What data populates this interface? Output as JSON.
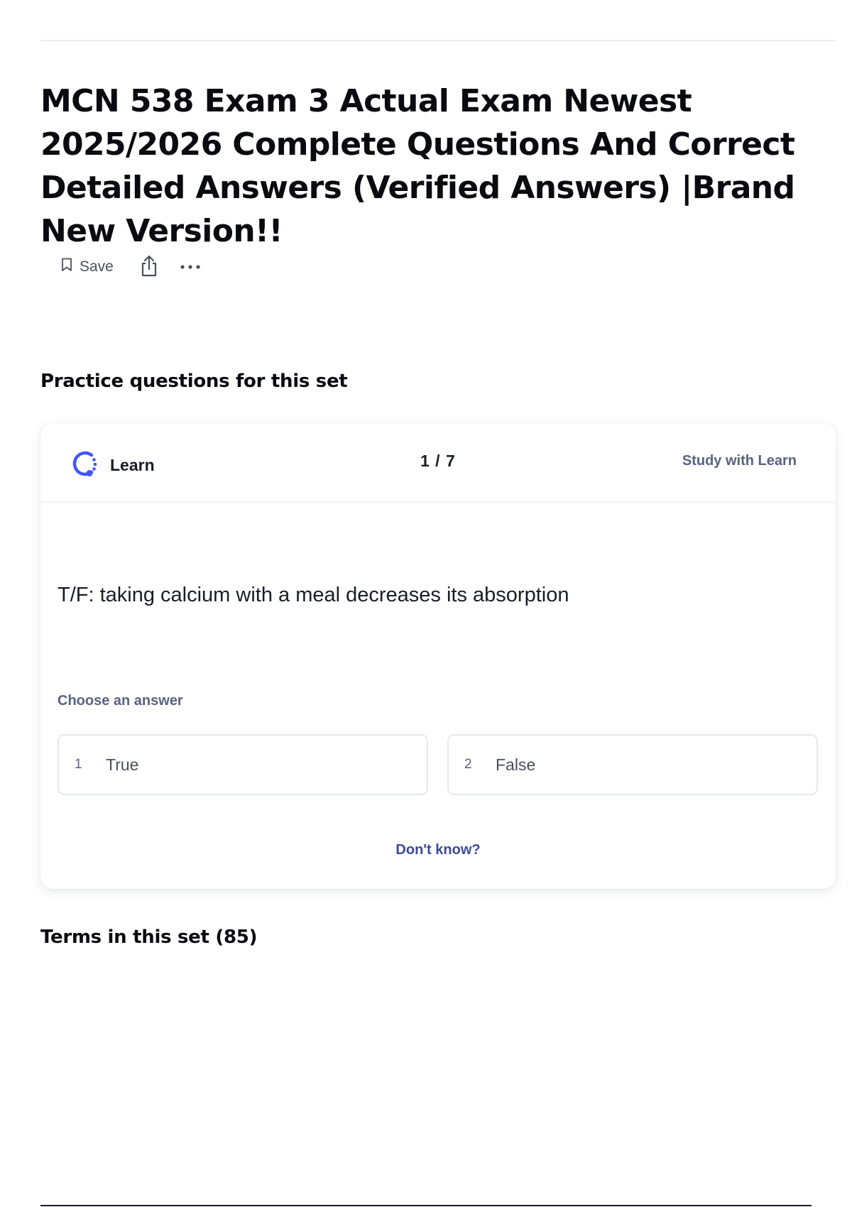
{
  "page": {
    "title": "MCN 538 Exam 3 Actual Exam Newest 2025/2026 Complete Questions And Correct Detailed Answers (Verified Answers) |Brand New Version!!"
  },
  "actions": {
    "save_label": "Save",
    "save_icon": "bookmark-icon",
    "share_icon": "share-icon",
    "more_icon": "more-horizontal-icon"
  },
  "practice": {
    "heading": "Practice questions for this set",
    "mode_label": "Learn",
    "mode_icon": "learn-icon",
    "progress": "1 / 7",
    "study_link": "Study with Learn",
    "question": "T/F: taking calcium with a meal decreases its absorption",
    "choose_label": "Choose an answer",
    "options": [
      {
        "number": "1",
        "text": "True"
      },
      {
        "number": "2",
        "text": "False"
      }
    ],
    "dont_know": "Don't know?"
  },
  "terms": {
    "heading": "Terms in this set (85)"
  },
  "colors": {
    "accent": "#4255ff",
    "link": "#3a4a9a",
    "muted": "#586380"
  }
}
